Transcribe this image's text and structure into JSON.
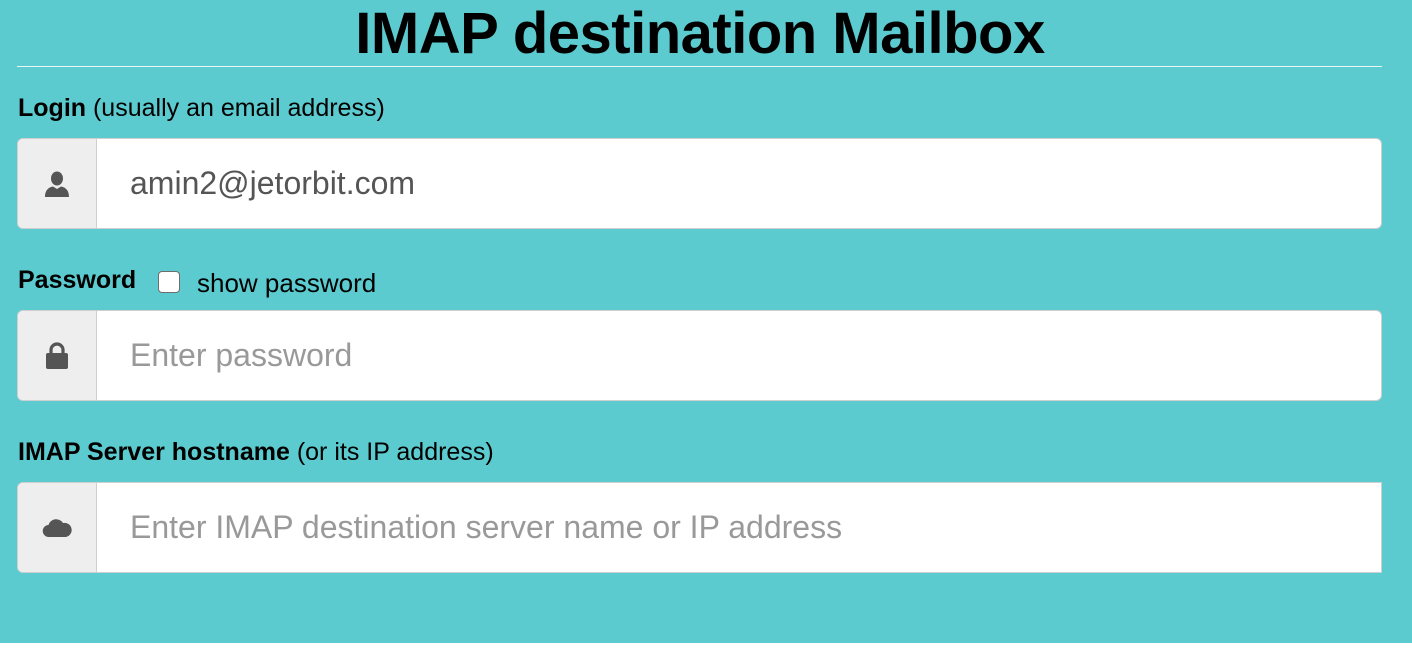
{
  "header": {
    "title": "IMAP destination Mailbox"
  },
  "login": {
    "label_bold": "Login",
    "label_hint": " (usually an email address)",
    "icon": "user-icon",
    "value": "amin2@jetorbit.com"
  },
  "password": {
    "label_bold": "Password",
    "show_password_label": "show password",
    "show_password_checked": false,
    "icon": "lock-icon",
    "value": "",
    "placeholder": "Enter password"
  },
  "host": {
    "label_bold": "IMAP Server hostname",
    "label_hint": " (or its IP address)",
    "icon": "cloud-icon",
    "value": "",
    "placeholder": "Enter IMAP destination server name or IP address"
  },
  "colors": {
    "panel_background": "#5ccbcf",
    "addon_background": "#eeeeee",
    "icon_color": "#555555"
  }
}
